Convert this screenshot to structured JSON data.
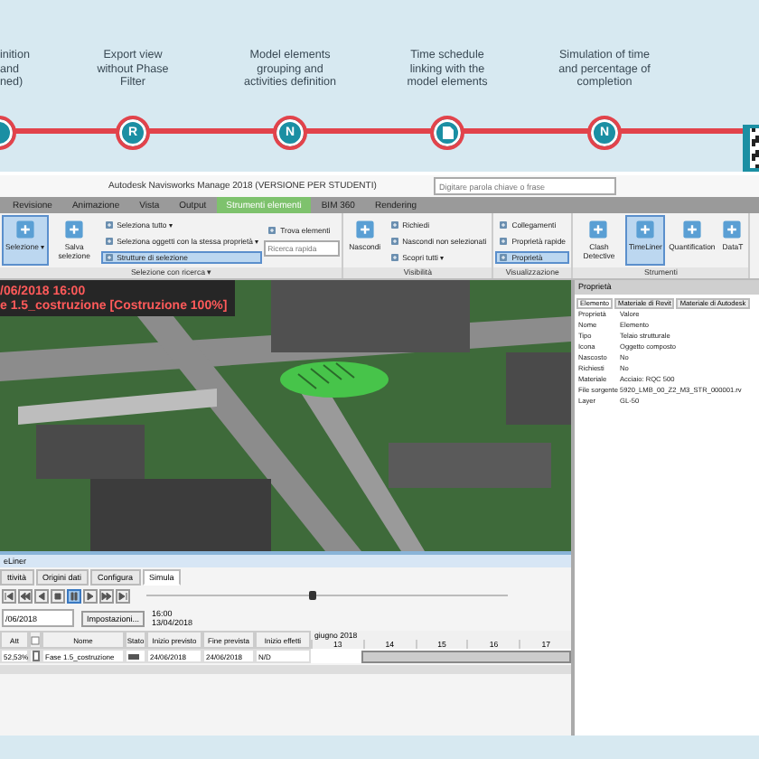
{
  "steps": [
    {
      "lines": [
        "inition",
        "and",
        "ned)"
      ],
      "marker": {
        "kind": "blank"
      }
    },
    {
      "lines": [
        "Export view",
        "without Phase",
        "Filter"
      ],
      "marker": {
        "kind": "letter",
        "letter": "R"
      }
    },
    {
      "lines": [
        "Model elements",
        "grouping and",
        "activities definition"
      ],
      "marker": {
        "kind": "letter",
        "letter": "N"
      }
    },
    {
      "lines": [
        "Time schedule",
        "linking with the",
        "model elements"
      ],
      "marker": {
        "kind": "doc"
      }
    },
    {
      "lines": [
        "Simulation of time",
        "and percentage of",
        "completion"
      ],
      "marker": {
        "kind": "letter",
        "letter": "N"
      }
    },
    {
      "marker": {
        "kind": "qr"
      }
    }
  ],
  "window": {
    "title": "Autodesk Navisworks Manage 2018 (VERSIONE PER STUDENTI)",
    "search": {
      "placeholder": "Digitare parola chiave o frase"
    }
  },
  "ribbon_tabs": [
    {
      "label": "Revisione",
      "selected": false
    },
    {
      "label": "Animazione",
      "selected": false
    },
    {
      "label": "Vista",
      "selected": false
    },
    {
      "label": "Output",
      "selected": false
    },
    {
      "label": "Strumenti elementi",
      "selected": true
    },
    {
      "label": "BIM 360",
      "selected": false
    },
    {
      "label": "Rendering",
      "selected": false
    }
  ],
  "ribbon_panels": [
    {
      "label": "Selezione con ricerca ▾",
      "columns": [
        {
          "kind": "large",
          "label": "Selezione ▾",
          "selected": true
        },
        {
          "kind": "large",
          "label": "Salva selezione",
          "selected": false
        },
        {
          "kind": "stack",
          "items": [
            {
              "kind": "button",
              "label": "Seleziona tutto ▾",
              "selected": false
            },
            {
              "kind": "button",
              "label": "Seleziona oggetti con la stessa proprietà ▾",
              "selected": false
            },
            {
              "kind": "button",
              "label": "Strutture di selezione",
              "selected": true
            }
          ]
        },
        {
          "kind": "stack",
          "items": [
            {
              "kind": "button",
              "label": "Trova elementi",
              "selected": false
            },
            {
              "kind": "field",
              "placeholder": "Ricerca rapida"
            }
          ]
        }
      ]
    },
    {
      "label": "Visibilità",
      "columns": [
        {
          "kind": "large",
          "label": "Nascondi",
          "selected": false
        },
        {
          "kind": "stack",
          "items": [
            {
              "kind": "button",
              "label": "Richiedi",
              "selected": false
            },
            {
              "kind": "button",
              "label": "Nascondi non selezionati",
              "selected": false
            },
            {
              "kind": "button",
              "label": "Scopri tutti ▾",
              "selected": false
            }
          ]
        }
      ]
    },
    {
      "label": "Visualizzazione",
      "columns": [
        {
          "kind": "stack",
          "items": [
            {
              "kind": "button",
              "label": "Collegamenti",
              "selected": false
            },
            {
              "kind": "button",
              "label": "Proprietà rapide",
              "selected": false
            },
            {
              "kind": "button",
              "label": "Proprietà",
              "selected": true
            }
          ]
        }
      ]
    },
    {
      "label": "Strumenti",
      "columns": [
        {
          "kind": "large",
          "label": "Clash Detective",
          "selected": false
        },
        {
          "kind": "large",
          "label": "TimeLiner",
          "selected": true
        },
        {
          "kind": "large",
          "label": "Quantification",
          "selected": false
        },
        {
          "kind": "large",
          "label": "DataT",
          "selected": false
        }
      ]
    }
  ],
  "viewport": {
    "overlay_lines": [
      "/06/2018 16:00",
      "e 1.5_costruzione [Costruzione 100%]"
    ]
  },
  "properties": {
    "title": "Proprietà",
    "tabs": [
      {
        "label": "Elemento",
        "selected": true
      },
      {
        "label": "Materiale di Revit",
        "selected": false
      },
      {
        "label": "Materiale di Autodesk",
        "selected": false
      }
    ],
    "header": [
      "Proprietà",
      "Valore"
    ],
    "rows": [
      [
        "Nome",
        "Elemento"
      ],
      [
        "Tipo",
        "Telaio strutturale"
      ],
      [
        "Icona",
        "Oggetto composto"
      ],
      [
        "Nascosto",
        "No"
      ],
      [
        "Richiesti",
        "No"
      ],
      [
        "Materiale",
        "Acciaio: RQC 500"
      ],
      [
        "File sorgente",
        "5920_LMB_00_Z2_M3_STR_000001.rv"
      ],
      [
        "Layer",
        "GL-50"
      ]
    ]
  },
  "timeliner": {
    "title": "eLiner",
    "tabs": [
      {
        "label": "ttività",
        "selected": false
      },
      {
        "label": "Origini dati",
        "selected": false
      },
      {
        "label": "Configura",
        "selected": false
      },
      {
        "label": "Simula",
        "selected": true
      }
    ],
    "playback_buttons": [
      {
        "kind": "first",
        "selected": false
      },
      {
        "kind": "rewind",
        "selected": false
      },
      {
        "kind": "back",
        "selected": false
      },
      {
        "kind": "stop",
        "selected": false
      },
      {
        "kind": "pause",
        "selected": true
      },
      {
        "kind": "play",
        "selected": false
      },
      {
        "kind": "forward",
        "selected": false
      },
      {
        "kind": "last",
        "selected": false
      }
    ],
    "slider": {
      "level": 0.45
    },
    "date_field": "/06/2018",
    "settings_button": "Impostazioni...",
    "time": "16:00",
    "date": "13/04/2018",
    "columns": [
      "Att",
      "Nome",
      "Stato",
      "Inizio previsto",
      "Fine prevista",
      "Inizio effetti"
    ],
    "rows": [
      {
        "cells": [
          "52,53%",
          "Fase 1.5_costruzione",
          "",
          "24/06/2018",
          "24/06/2018",
          "N/D"
        ],
        "checked": false
      }
    ],
    "gantt": {
      "month": "giugno 2018",
      "days": [
        "13",
        "14",
        "15",
        "16",
        "17"
      ]
    }
  }
}
